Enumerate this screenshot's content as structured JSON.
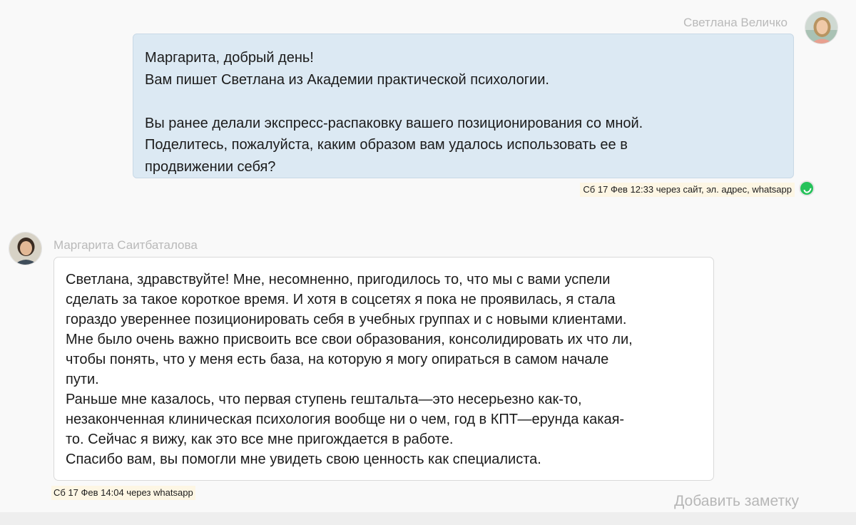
{
  "messages": [
    {
      "direction": "outgoing",
      "sender": "Светлана Величко",
      "avatar_icon": "woman-avatar-photo",
      "lines": [
        "Маргарита, добрый день!",
        "Вам пишет Светлана из Академии практической психологии.",
        "",
        "Вы ранее делали экспресс-распаковку вашего позиционирования со мной.",
        "Поделитесь, пожалуйста, каким образом вам удалось использовать ее в",
        "продвижении себя?"
      ],
      "meta": "Сб 17 Фев 12:33 через сайт, эл. адрес, whatsapp",
      "channel_icon": "whatsapp-icon"
    },
    {
      "direction": "incoming",
      "sender": "Маргарита Саитбаталова",
      "avatar_icon": "woman-avatar-photo",
      "lines": [
        "Светлана, здравствуйте! Мне, несомненно, пригодилось то, что мы с вами успели",
        "сделать за такое короткое время. И хотя в соцсетях я пока не проявилась, я стала",
        "гораздо увереннее позиционировать себя в учебных группах и с новыми клиентами.",
        "Мне было очень важно присвоить все свои образования, консолидировать их что ли,",
        "чтобы понять, что у меня есть база, на которую я могу опираться в самом начале",
        "пути.",
        "Раньше мне казалось, что первая ступень гештальта—это несерьезно как-то,",
        "незаконченная клиническая психология вообще ни о чем, год в КПТ—ерунда какая-",
        "то. Сейчас я вижу, как это все мне пригождается в работе.",
        "Спасибо вам, вы помогли мне увидеть свою ценность как специалиста."
      ],
      "meta": "Сб 17 Фев 14:04 через whatsapp"
    }
  ],
  "add_note_label": "Добавить заметку",
  "colors": {
    "outgoing_bubble": "#dce9f3",
    "incoming_bubble": "#ffffff",
    "meta_highlight": "#fdf6e4",
    "whatsapp": "#25c25a",
    "muted_text": "#b9b9b9"
  }
}
